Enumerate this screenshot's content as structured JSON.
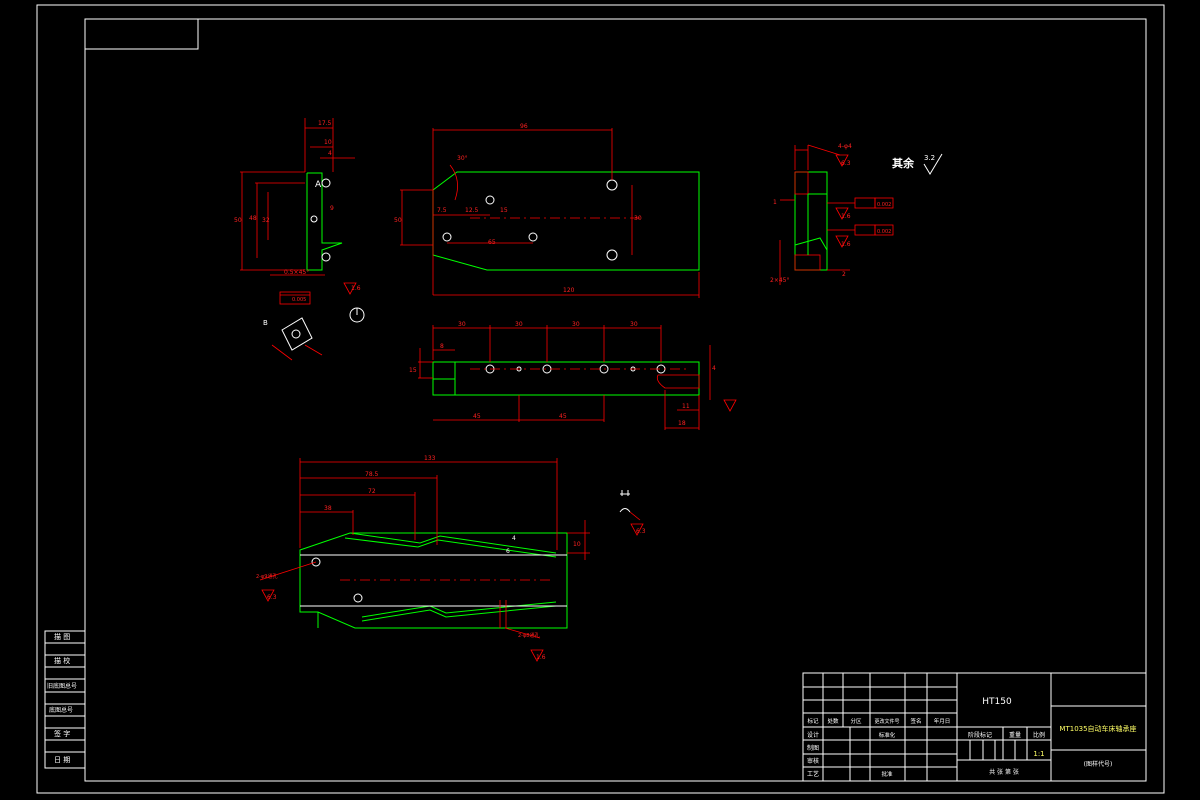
{
  "side_panel": {
    "rows": [
      "描 图",
      "描 校",
      "旧底图总号",
      "底图总号",
      "签 字",
      "日 期"
    ]
  },
  "title_block": {
    "material": "HT150",
    "part_name": "MT1035自动车床轴承座",
    "drawing_code": "(图样代号)",
    "scale_label": "比例",
    "scale_value": "1:1",
    "weight_label": "重量",
    "stage_label": "阶段标记",
    "sheet_label": "共 张 第 张",
    "rev_headers": [
      "标记",
      "处数",
      "分区",
      "更改文件号",
      "签名",
      "年月日"
    ],
    "roles": [
      "设计",
      "制图",
      "审核",
      "工艺"
    ],
    "std_label": "标准化",
    "approve_label": "批准"
  },
  "notes": {
    "other_roughness_label": "其余",
    "other_roughness_value": "3.2"
  },
  "tolerances": {
    "flatness_1": "0.002",
    "flatness_2": "0.002",
    "perp_1": "0.005"
  },
  "dimensions": {
    "v1_top": "17.5",
    "v1_mid": "10",
    "v1_small": "4",
    "v1_h1": "50",
    "v1_h2": "48",
    "v1_h3": "32",
    "v1_h4": "9",
    "v1_bottom": "0.5×45°",
    "main_top": "96",
    "main_angle": "30°",
    "main_75": "7.5",
    "main_125": "12.5",
    "main_15": "15",
    "main_65": "65",
    "main_30": "30",
    "main_h": "50",
    "main_bottom": "120",
    "mid_30a": "30",
    "mid_30b": "30",
    "mid_30c": "30",
    "mid_30d": "30",
    "mid_8": "8",
    "mid_15": "15",
    "mid_45a": "45",
    "mid_45b": "45",
    "mid_11": "11",
    "mid_18": "18",
    "mid_4": "4",
    "bot_133": "133",
    "bot_785": "78.5",
    "bot_72": "72",
    "bot_38": "38",
    "bot_h": "10",
    "bot_hole1": "2-φ9通孔",
    "bot_hole2": "2-φ8通孔",
    "rough_63": "6.3",
    "rough_16": "1.6",
    "sec_d": "4-φ4",
    "sec_1": "1",
    "sec_2": "2",
    "sec_245": "2×45°"
  },
  "labels": {
    "view_a": "A",
    "view_b": "B",
    "tiny_1": "4",
    "tiny_2": "6"
  }
}
